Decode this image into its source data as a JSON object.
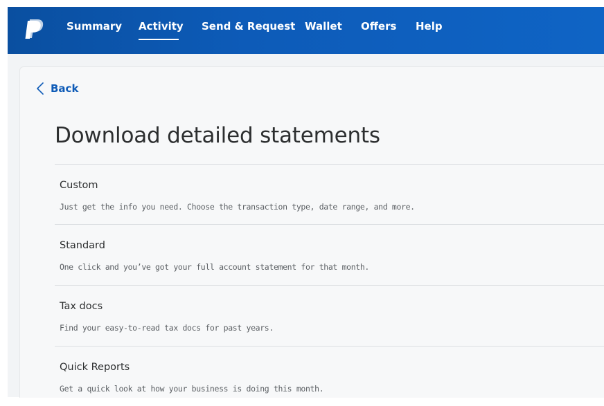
{
  "nav": {
    "items": [
      {
        "label": "Summary"
      },
      {
        "label": "Activity"
      },
      {
        "label": "Send & Request"
      },
      {
        "label": "Wallet"
      },
      {
        "label": "Offers"
      },
      {
        "label": "Help"
      }
    ],
    "active": "Activity"
  },
  "back": {
    "label": "Back"
  },
  "page": {
    "title": "Download detailed statements"
  },
  "options": [
    {
      "title": "Custom",
      "description": "Just get the info you need. Choose the transaction type, date range, and more."
    },
    {
      "title": "Standard",
      "description": "One click and you’ve got your full account statement for that month."
    },
    {
      "title": "Tax docs",
      "description": "Find your easy-to-read tax docs for past years."
    },
    {
      "title": "Quick Reports",
      "description": "Get a quick look at how your business is doing this month."
    }
  ],
  "colors": {
    "nav_background": "#0d5bb8",
    "link": "#0e5bb7",
    "text_primary": "#2c2e2f",
    "text_secondary": "#5b5f63"
  },
  "icons": {
    "logo": "paypal-logo-icon",
    "back": "chevron-left-icon"
  }
}
